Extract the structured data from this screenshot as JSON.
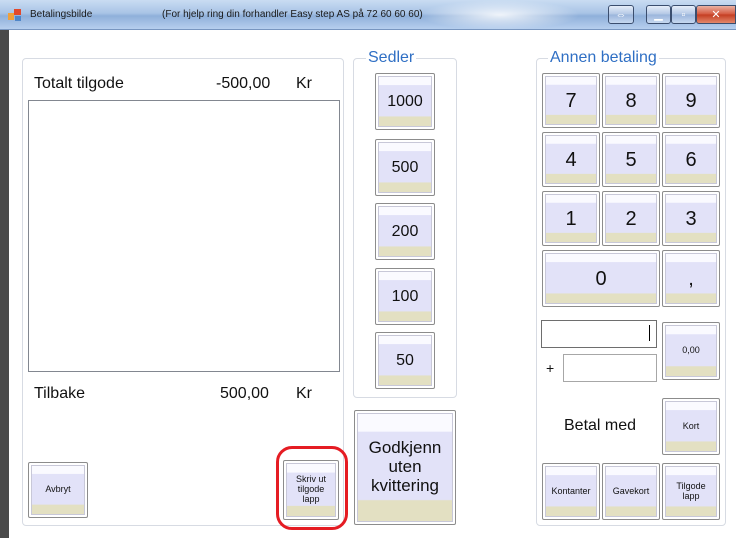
{
  "window": {
    "title": "Betalingsbilde",
    "subtitle": "(For hjelp ring din forhandler Easy step AS  på 72 60 60 60)",
    "controls": {
      "restore": "⇔",
      "minimize": "▁",
      "maximize": "▫"
    }
  },
  "summary": {
    "total_label": "Totalt tilgode",
    "total_value": "-500,00",
    "total_currency": "Kr",
    "change_label": "Tilbake",
    "change_value": "500,00",
    "change_currency": "Kr"
  },
  "actions": {
    "cancel": "Avbryt",
    "print_voucher": "Skriv ut\ntilgode\nlapp",
    "approve_no_receipt": "Godkjenn\nuten\nkvittering"
  },
  "notes": {
    "title": "Sedler",
    "denominations": [
      "1000",
      "500",
      "200",
      "100",
      "50"
    ]
  },
  "other_payment": {
    "title": "Annen betaling",
    "keypad": [
      "7",
      "8",
      "9",
      "4",
      "5",
      "6",
      "1",
      "2",
      "3"
    ],
    "zero": "0",
    "comma": ",",
    "amount_input_value": "",
    "plus_label": "+",
    "extra_input_value": "",
    "amount_display": "0,00",
    "pay_with_label": "Betal med",
    "card": "Kort",
    "cash": "Kontanter",
    "gift_card": "Gavekort",
    "voucher": "Tilgode\nlapp"
  },
  "colors": {
    "accent": "#2f6fc4",
    "highlight": "#e51c23",
    "button_face": "#e2e2f8",
    "button_base": "#e3e0c2"
  }
}
